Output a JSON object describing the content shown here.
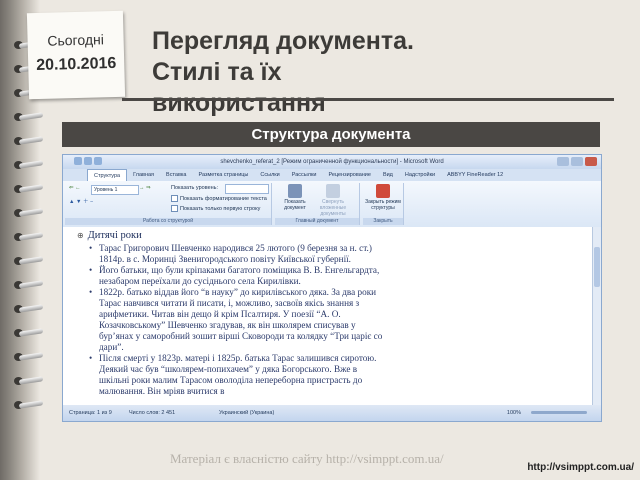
{
  "note": {
    "today_label": "Сьогодні",
    "date": "20.10.2016"
  },
  "slide": {
    "title_line1": "Перегляд документа.",
    "title_line2": "Стилі та їх",
    "title_line3": "використання",
    "section_bar": "Структура документа"
  },
  "word": {
    "window_title": "shevchenko_referat_2 [Режим ограниченной функциональности] - Microsoft Word",
    "tabs": [
      {
        "label": "Структура",
        "active": true
      },
      {
        "label": "Главная"
      },
      {
        "label": "Вставка"
      },
      {
        "label": "Разметка страницы"
      },
      {
        "label": "Ссылки"
      },
      {
        "label": "Рассылки"
      },
      {
        "label": "Рецензирование"
      },
      {
        "label": "Вид"
      },
      {
        "label": "Надстройки"
      },
      {
        "label": "ABBYY FineReader 12"
      }
    ],
    "ribbon": {
      "level_combo": "Уровень 1",
      "show_level_label": "Показать уровень:",
      "show_text_formatting": "Показать форматирование текста",
      "show_first_line": "Показать только первую строку",
      "group_outline_tools": "Работа со структурой",
      "show_document_label": "Показать документ",
      "collapse_subdocs_label": "Свернуть вложенные документы",
      "group_master_doc": "Главный документ",
      "close_outline_label": "Закрыть режим структуры",
      "group_close": "Закрыть"
    },
    "document": {
      "heading": "Дитячі роки",
      "bullets": [
        "Тарас Григорович Шевченко народився 25 лютого (9 березня за н. ст.) 1814р. в с. Моринці Звенигородського повіту Київської губернії.",
        "Його батьки, що були кріпаками багатого поміщика В. В. Енгельгардта, незабаром переїхали до сусіднього села Кирилівки.",
        "1822р. батько віддав його “в науку” до кирилівського дяка. За два роки Тарас навчився читати й писати, і, можливо, засвоїв якісь знання з арифметики. Читав він дещо й крім Псалтиря. У поезії “А. О. Козачковському” Шевченко згадував, як він школярем списував у бур’янах у саморобний зошит вірші Сковороди та колядку “Три царіє со дари”.",
        "Після смерті у 1823р. матері і 1825р. батька Тарас залишився сиротою. Деякий час був “школярем-попихачем” у дяка Богорського. Вже в шкільні роки малим Тарасом оволоділа непереборна пристрасть до малювання. Він мріяв вчитися в"
      ]
    },
    "statusbar": {
      "page": "Страница: 1 из 9",
      "words": "Число слов: 2 451",
      "language": "Украинский (Украина)",
      "zoom": "100%"
    }
  },
  "footer": {
    "watermark": "Матеріал є власністю сайту http://vsimppt.com.ua/",
    "site": "http://vsimppt.com.ua/"
  }
}
